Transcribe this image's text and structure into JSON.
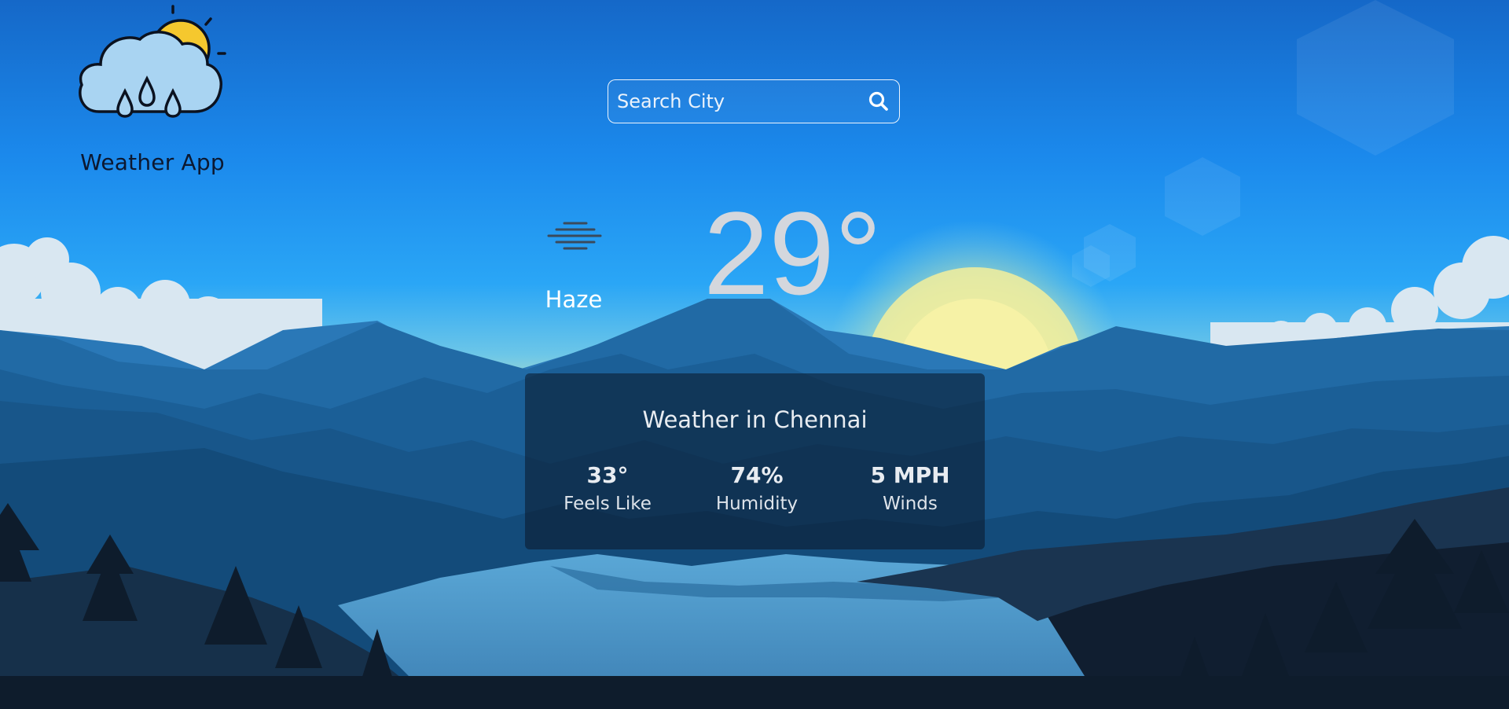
{
  "app": {
    "name": "Weather App",
    "logo_icon": "cloud-sun-rain-icon"
  },
  "search": {
    "placeholder": "Search City",
    "value": "",
    "icon": "search-icon"
  },
  "current": {
    "condition": "Haze",
    "condition_icon": "haze-icon",
    "temperature": "29°"
  },
  "details": {
    "title": "Weather in Chennai",
    "stats": [
      {
        "value": "33°",
        "label": "Feels Like"
      },
      {
        "value": "74%",
        "label": "Humidity"
      },
      {
        "value": "5 MPH",
        "label": "Winds"
      }
    ]
  },
  "colors": {
    "sky_top": "#1468c9",
    "sky_mid": "#1e96f5",
    "sun": "#f2ec9a",
    "card_bg": "rgba(10,26,44,0.58)",
    "temperature_text": "#d4d7dd"
  }
}
